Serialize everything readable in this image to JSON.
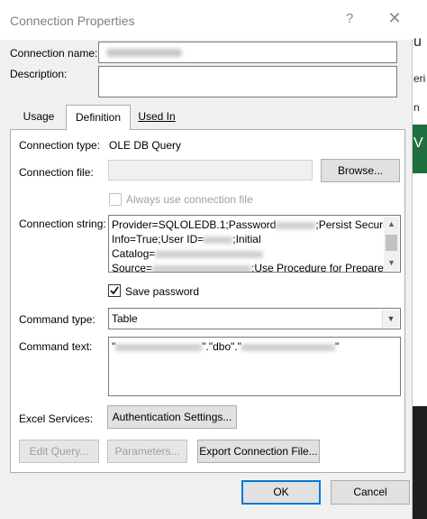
{
  "dialog": {
    "title": "Connection Properties",
    "help_glyph": "?",
    "close_glyph": "✕"
  },
  "header": {
    "name_label": "Connection name:",
    "description_label": "Description:"
  },
  "tabs": [
    {
      "label": "Usage"
    },
    {
      "label": "Definition"
    },
    {
      "label": "Used In"
    }
  ],
  "definition": {
    "connection_type_label": "Connection type:",
    "connection_type_value": "OLE DB Query",
    "connection_file_label": "Connection file:",
    "browse_label": "Browse...",
    "always_use_label": "Always use connection file",
    "connection_string_label": "Connection string:",
    "connection_string_lines": [
      "Provider=SQLOLEDB.1;Password",
      ";Persist Security",
      "Info=True;User ID=",
      ";Initial",
      "Catalog=",
      "Source=",
      ";Use Procedure for Prepare="
    ],
    "save_password_label": "Save password",
    "save_password_checked": true,
    "command_type_label": "Command type:",
    "command_type_value": "Table",
    "command_text_label": "Command text:",
    "command_text_fragments": [
      "\"",
      "\".\"dbo\".\"",
      "\""
    ],
    "excel_services_label": "Excel Services:",
    "auth_settings_label": "Authentication Settings...",
    "edit_query_label": "Edit Query...",
    "parameters_label": "Parameters...",
    "export_label": "Export Connection File..."
  },
  "footer": {
    "ok_label": "OK",
    "cancel_label": "Cancel"
  },
  "background_app": {
    "text_1": "u",
    "text_2": "eri",
    "text_3": "n",
    "text_4": "V"
  }
}
